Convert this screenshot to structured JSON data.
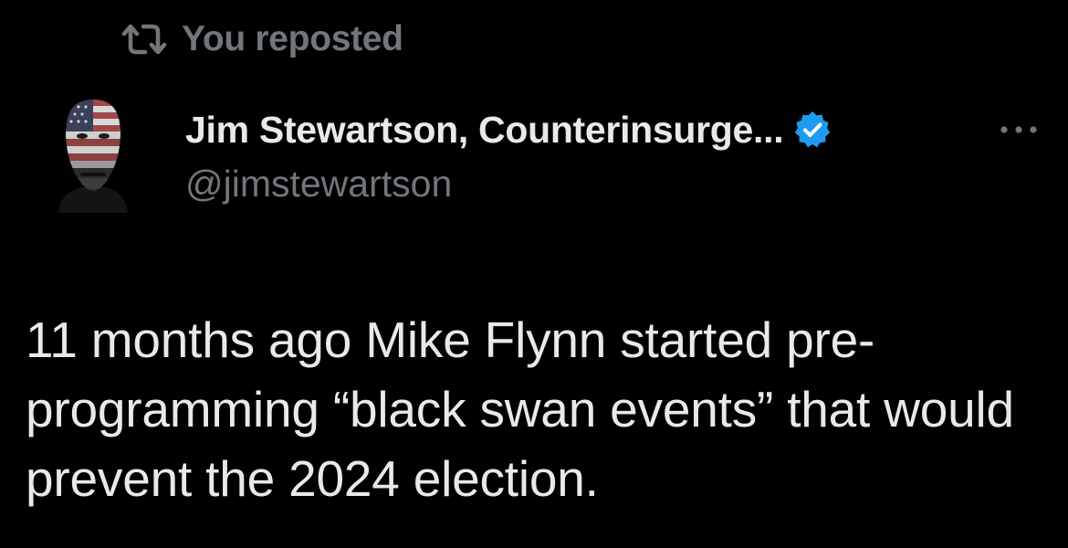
{
  "repost": {
    "icon": "repost-icon",
    "label": "You reposted"
  },
  "author": {
    "avatar_icon": "avatar",
    "display_name": "Jim Stewartson, Counterinsurge...",
    "verified_icon": "verified-badge-icon",
    "handle": "@jimstewartson"
  },
  "actions": {
    "more_icon": "more-options-icon"
  },
  "tweet": {
    "text": "11 months ago Mike Flynn started pre-programming “black swan events” that would prevent the 2024 election."
  },
  "colors": {
    "background": "#000000",
    "primary_text": "#e7e9ea",
    "secondary_text": "#71767b",
    "verified": "#1d9bf0"
  }
}
